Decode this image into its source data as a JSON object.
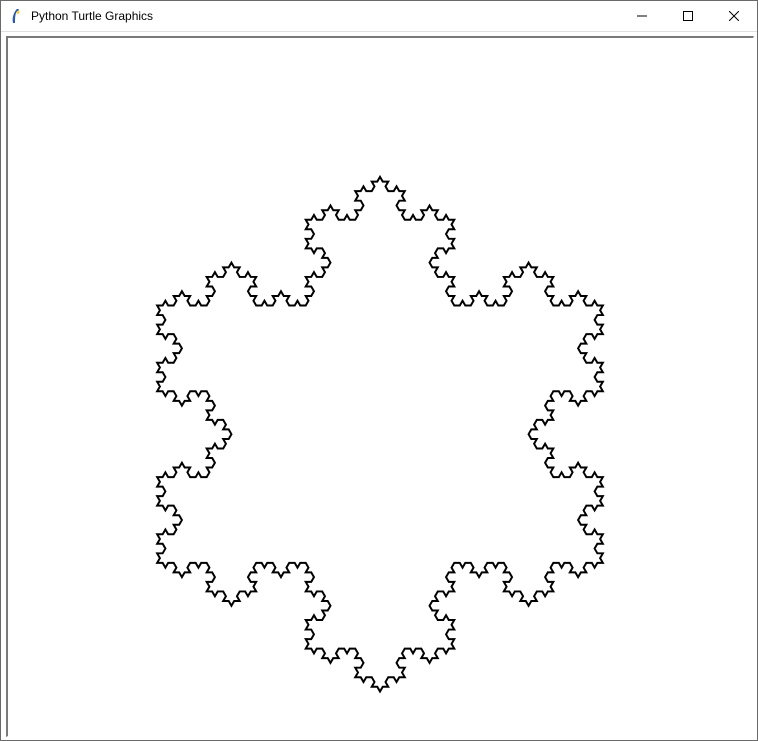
{
  "window": {
    "title": "Python Turtle Graphics",
    "icon_name": "python-feather-icon",
    "controls": {
      "minimize": "Minimize",
      "maximize": "Maximize",
      "close": "Close"
    }
  },
  "canvas": {
    "content": "koch-snowflake",
    "iterations": 4,
    "sides": 3,
    "stroke_color": "#000000",
    "background": "#ffffff"
  }
}
